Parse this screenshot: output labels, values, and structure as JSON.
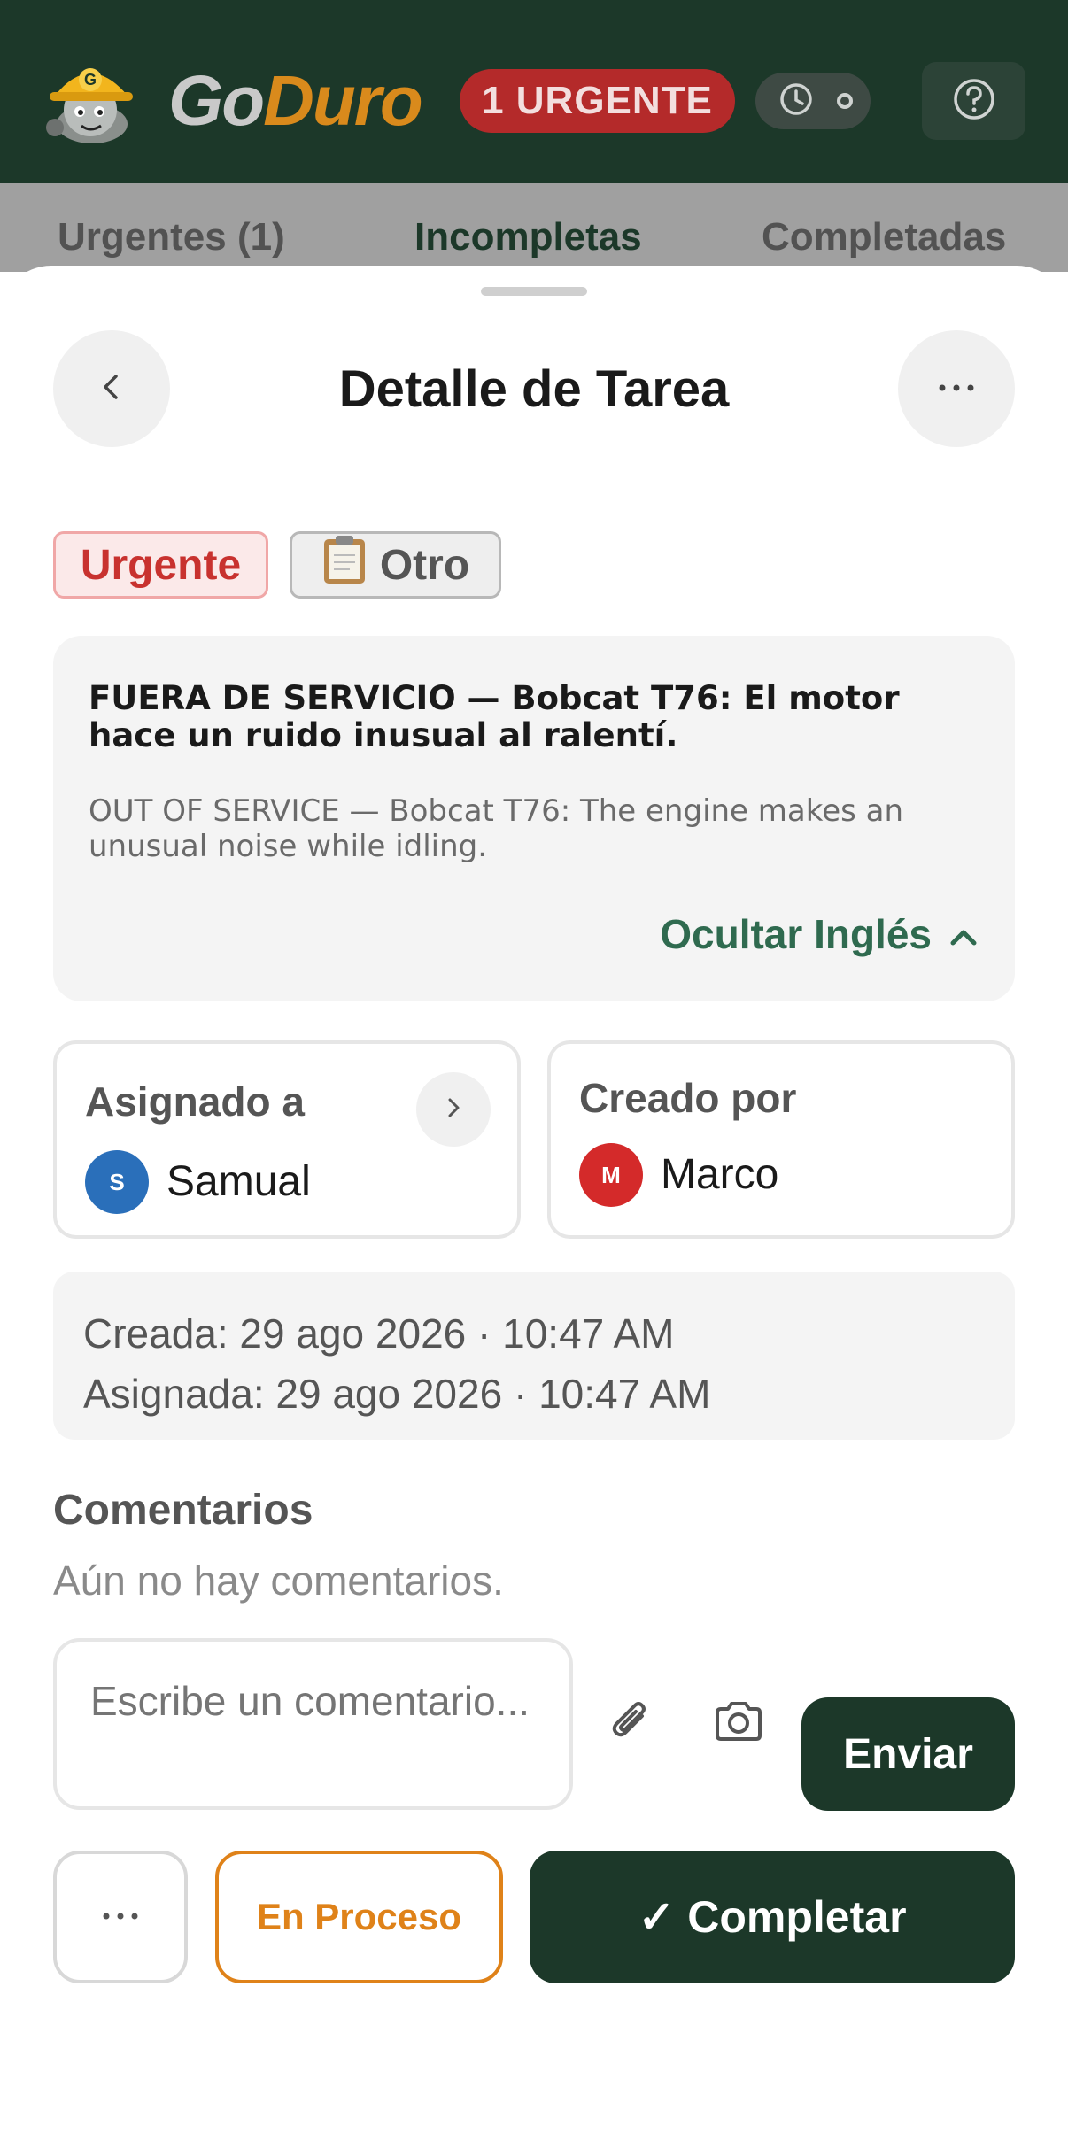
{
  "header": {
    "logo_go": "Go",
    "logo_duro": "Duro",
    "mascot_letter": "G",
    "urgent_pill": "1 URGENTE",
    "timer_icon": "clock-icon",
    "help_icon": "question-icon"
  },
  "tabs": [
    {
      "label": "Urgentes (1)",
      "active": false
    },
    {
      "label": "Incompletas",
      "active": true
    },
    {
      "label": "Completadas",
      "active": false
    }
  ],
  "sheet": {
    "title": "Detalle de Tarea",
    "back_icon": "chevron-left-icon",
    "more_icon": "ellipsis-icon"
  },
  "tags": {
    "priority": "Urgente",
    "category_icon": "clipboard-icon",
    "category": "Otro"
  },
  "description": {
    "spanish": "FUERA DE SERVICIO — Bobcat T76: El motor hace un ruido inusual al ralentí.",
    "english": "OUT OF SERVICE — Bobcat T76: The engine makes an unusual noise while idling.",
    "toggle_label": "Ocultar Inglés"
  },
  "assigned": {
    "label": "Asignado a",
    "initial": "S",
    "name": "Samual",
    "avatar_color": "#2a6fba"
  },
  "creator": {
    "label": "Creado por",
    "initial": "M",
    "name": "Marco",
    "avatar_color": "#d42a2a"
  },
  "dates": {
    "created": "Creada: 29 ago 2026 · 10:47 AM",
    "assigned": "Asignada: 29 ago 2026 · 10:47 AM"
  },
  "comments": {
    "title": "Comentarios",
    "empty": "Aún no hay comentarios.",
    "input_placeholder": "Escribe un comentario...",
    "input_value": "",
    "attach_icon": "paperclip-icon",
    "camera_icon": "camera-icon",
    "send_label": "Enviar"
  },
  "actions": {
    "more_icon": "ellipsis-icon",
    "process_label": "En Proceso",
    "complete_label": "✓ Completar"
  },
  "colors": {
    "brand_dark": "#1c3829",
    "accent_orange": "#df8219",
    "urgent_red": "#c8322f",
    "link_green": "#2f6a4f"
  }
}
